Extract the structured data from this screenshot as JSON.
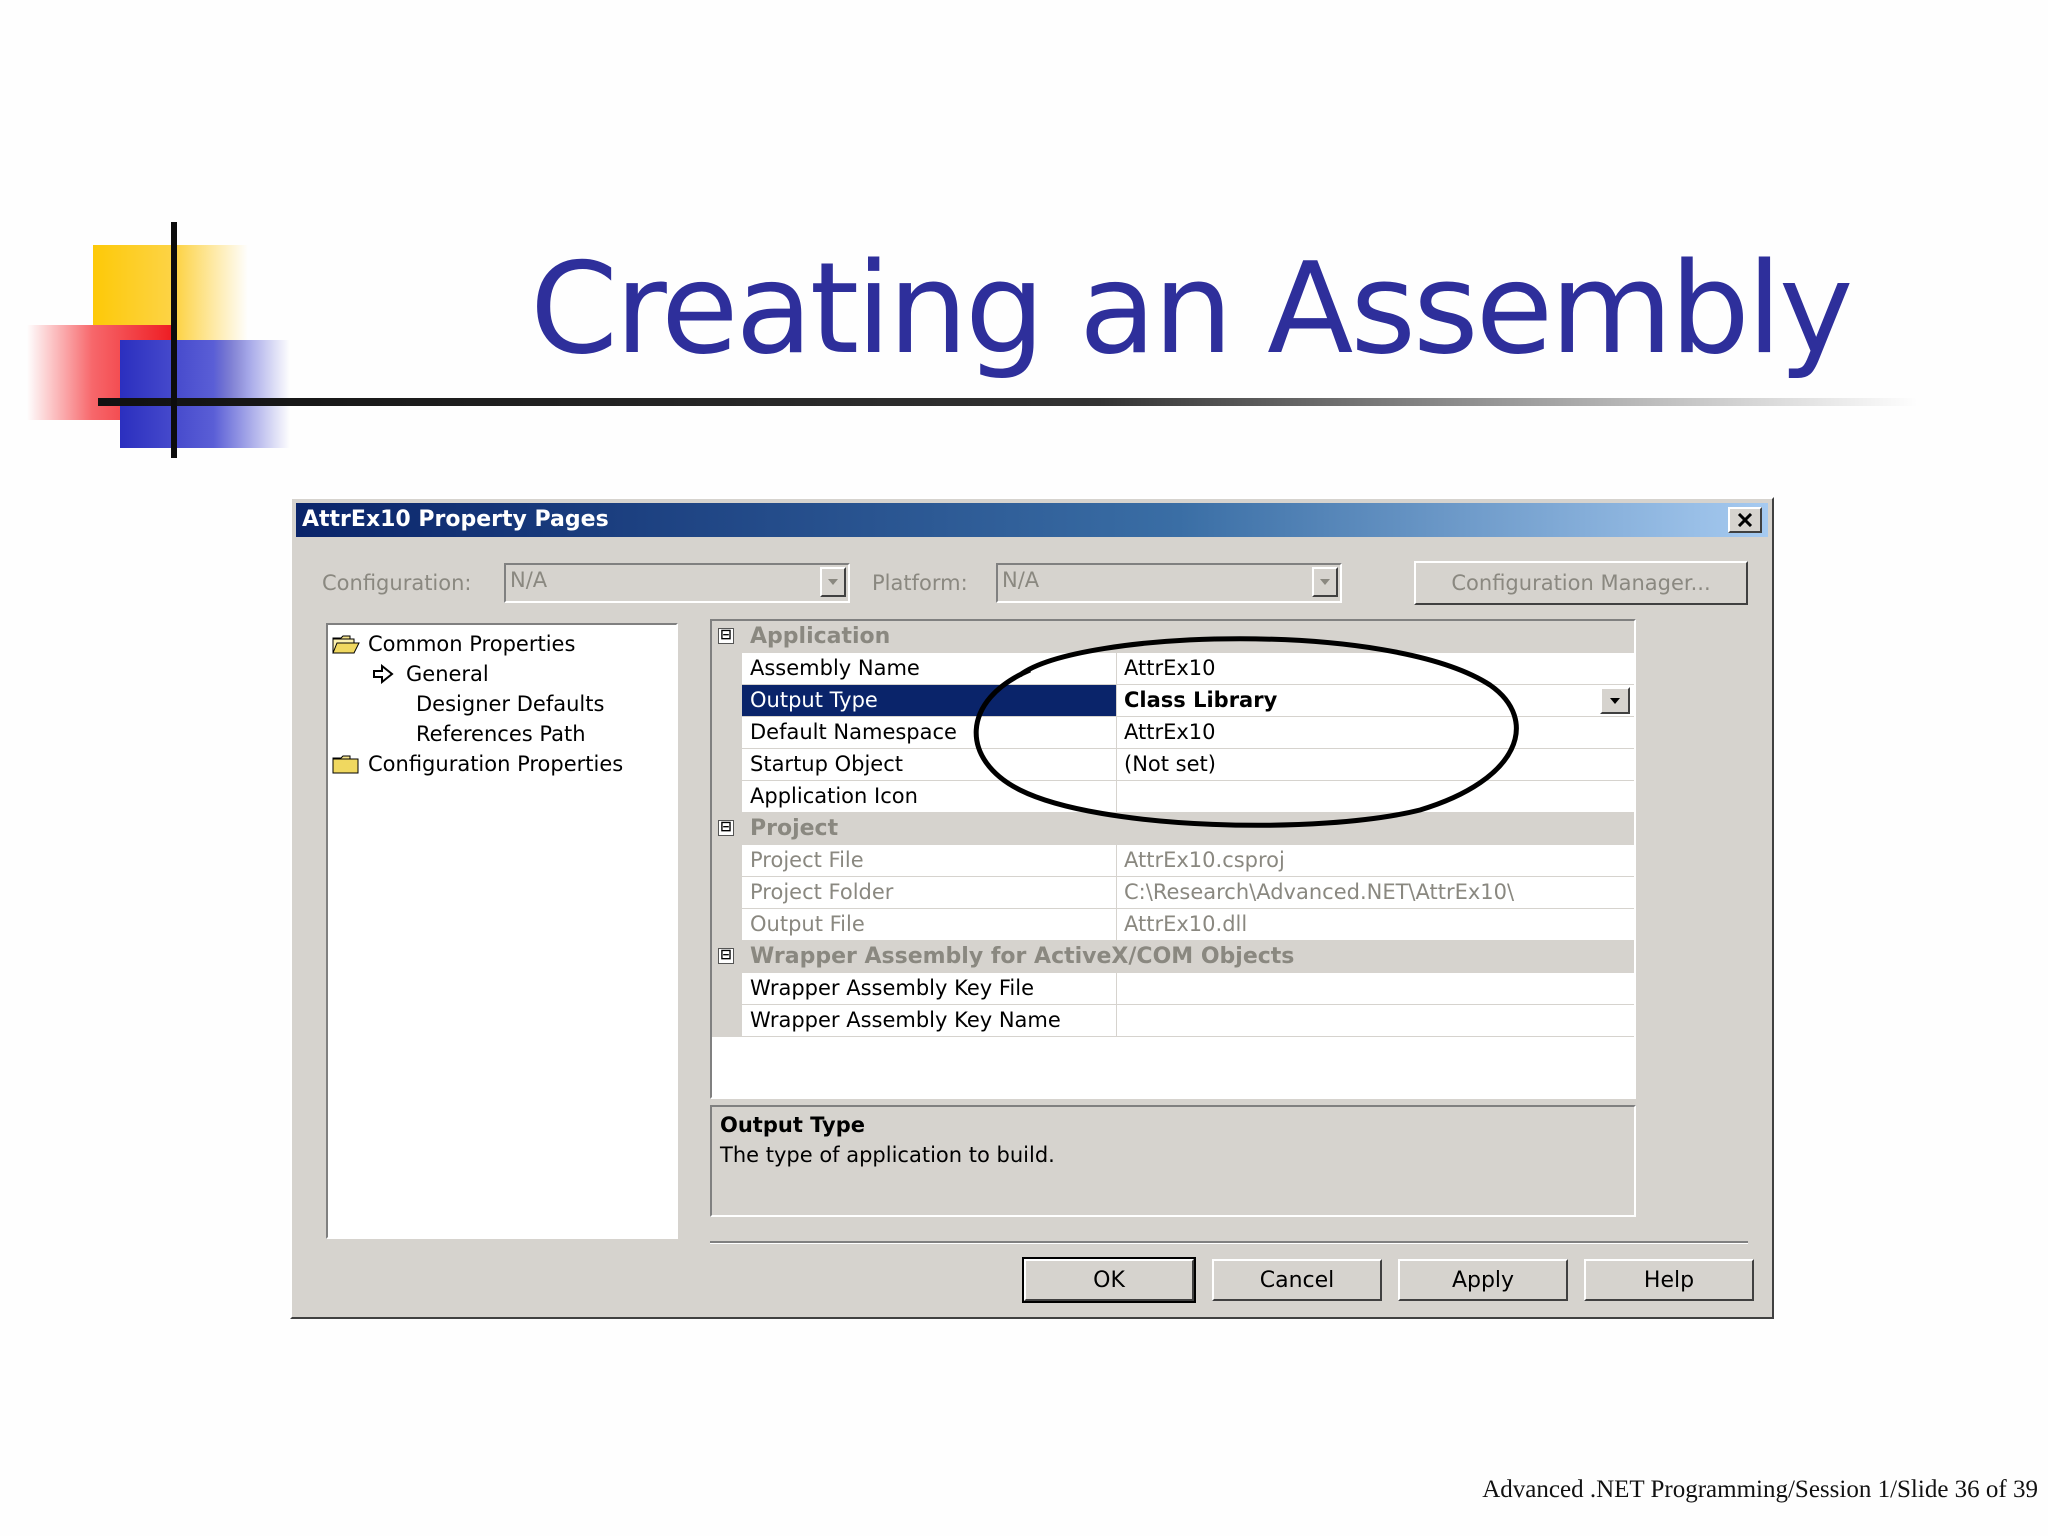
{
  "slide": {
    "title": "Creating an Assembly",
    "footer": "Advanced .NET Programming/Session 1/Slide 36 of 39"
  },
  "dialog": {
    "title": "AttrEx10 Property Pages",
    "configuration_label": "Configuration:",
    "configuration_value": "N/A",
    "platform_label": "Platform:",
    "platform_value": "N/A",
    "config_manager_label": "Configuration Manager...",
    "tree": [
      {
        "label": "Common Properties",
        "icon": "open-folder-icon"
      },
      {
        "label": "General",
        "icon": "arrow-icon"
      },
      {
        "label": "Designer Defaults",
        "icon": ""
      },
      {
        "label": "References Path",
        "icon": ""
      },
      {
        "label": "Configuration Properties",
        "icon": "folder-icon"
      }
    ],
    "grid": {
      "categories": [
        {
          "label": "Application",
          "toggle": "⊟"
        },
        {
          "label": "Project",
          "toggle": "⊟"
        },
        {
          "label": "Wrapper Assembly for ActiveX/COM Objects",
          "toggle": "⊟"
        }
      ],
      "application": [
        {
          "name": "Assembly Name",
          "value": "AttrEx10"
        },
        {
          "name": "Output Type",
          "value": "Class Library"
        },
        {
          "name": "Default Namespace",
          "value": "AttrEx10"
        },
        {
          "name": "Startup Object",
          "value": "(Not set)"
        },
        {
          "name": "Application Icon",
          "value": ""
        }
      ],
      "project": [
        {
          "name": "Project File",
          "value": "AttrEx10.csproj"
        },
        {
          "name": "Project Folder",
          "value": "C:\\Research\\Advanced.NET\\AttrEx10\\"
        },
        {
          "name": "Output File",
          "value": "AttrEx10.dll"
        }
      ],
      "wrapper": [
        {
          "name": "Wrapper Assembly Key File",
          "value": ""
        },
        {
          "name": "Wrapper Assembly Key Name",
          "value": ""
        }
      ]
    },
    "description": {
      "title": "Output Type",
      "text": "The type of application to build."
    },
    "buttons": {
      "ok": "OK",
      "cancel": "Cancel",
      "apply": "Apply",
      "help": "Help"
    }
  },
  "colors": {
    "title_blue": "#2e2f9b",
    "selection": "#0a246a",
    "dialog_face": "#d6d3ce"
  }
}
